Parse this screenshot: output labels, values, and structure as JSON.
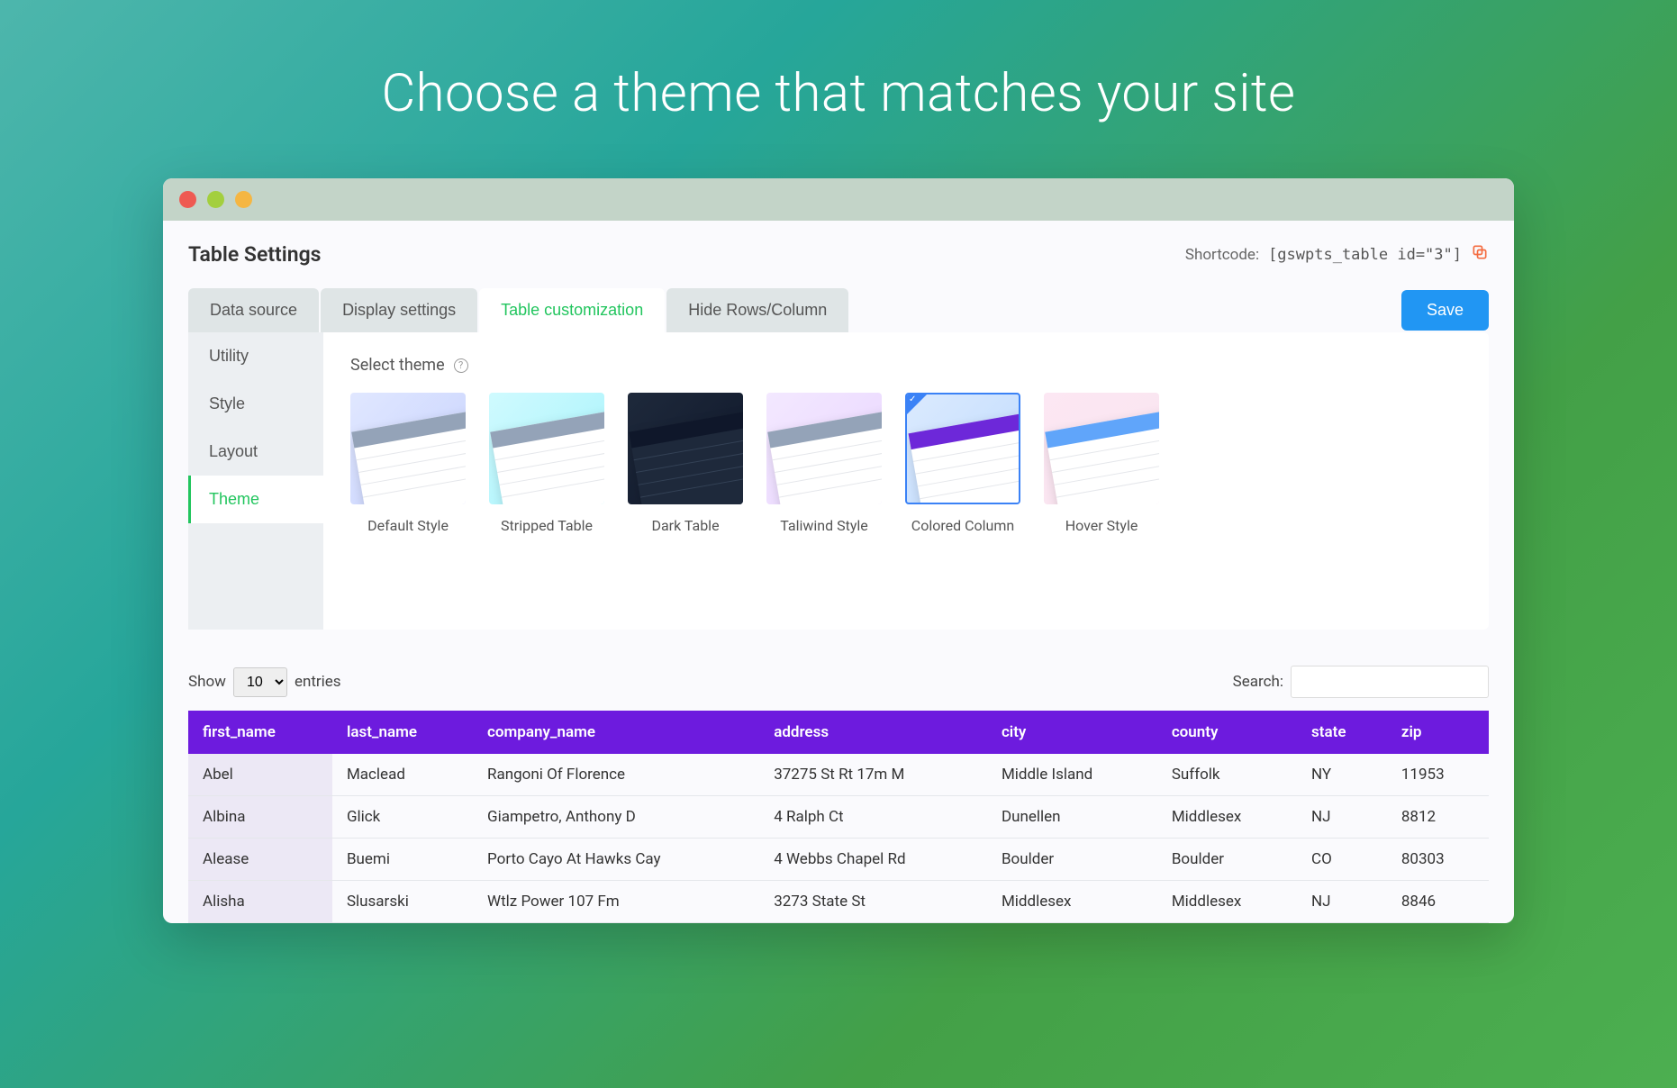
{
  "hero": {
    "title": "Choose a theme that matches your site"
  },
  "header": {
    "title": "Table Settings",
    "shortcode_label": "Shortcode:",
    "shortcode_value": "[gswpts_table id=\"3\"]"
  },
  "tabs": {
    "items": [
      {
        "label": "Data source"
      },
      {
        "label": "Display settings"
      },
      {
        "label": "Table customization",
        "active": true
      },
      {
        "label": "Hide Rows/Column"
      }
    ],
    "save_label": "Save"
  },
  "side_tabs": [
    {
      "label": "Utility"
    },
    {
      "label": "Style"
    },
    {
      "label": "Layout"
    },
    {
      "label": "Theme",
      "active": true
    }
  ],
  "theme_section": {
    "label": "Select theme",
    "themes": [
      {
        "name": "Default Style"
      },
      {
        "name": "Stripped Table"
      },
      {
        "name": "Dark Table"
      },
      {
        "name": "Taliwind Style"
      },
      {
        "name": "Colored Column",
        "selected": true
      },
      {
        "name": "Hover Style"
      }
    ]
  },
  "table_controls": {
    "show_label": "Show",
    "entries_label": "entries",
    "page_size": "10",
    "search_label": "Search:",
    "search_value": ""
  },
  "table": {
    "columns": [
      "first_name",
      "last_name",
      "company_name",
      "address",
      "city",
      "county",
      "state",
      "zip"
    ],
    "rows": [
      [
        "Abel",
        "Maclead",
        "Rangoni Of Florence",
        "37275 St Rt 17m M",
        "Middle Island",
        "Suffolk",
        "NY",
        "11953"
      ],
      [
        "Albina",
        "Glick",
        "Giampetro, Anthony D",
        "4 Ralph Ct",
        "Dunellen",
        "Middlesex",
        "NJ",
        "8812"
      ],
      [
        "Alease",
        "Buemi",
        "Porto Cayo At Hawks Cay",
        "4 Webbs Chapel Rd",
        "Boulder",
        "Boulder",
        "CO",
        "80303"
      ],
      [
        "Alisha",
        "Slusarski",
        "Wtlz Power 107 Fm",
        "3273 State St",
        "Middlesex",
        "Middlesex",
        "NJ",
        "8846"
      ]
    ]
  }
}
